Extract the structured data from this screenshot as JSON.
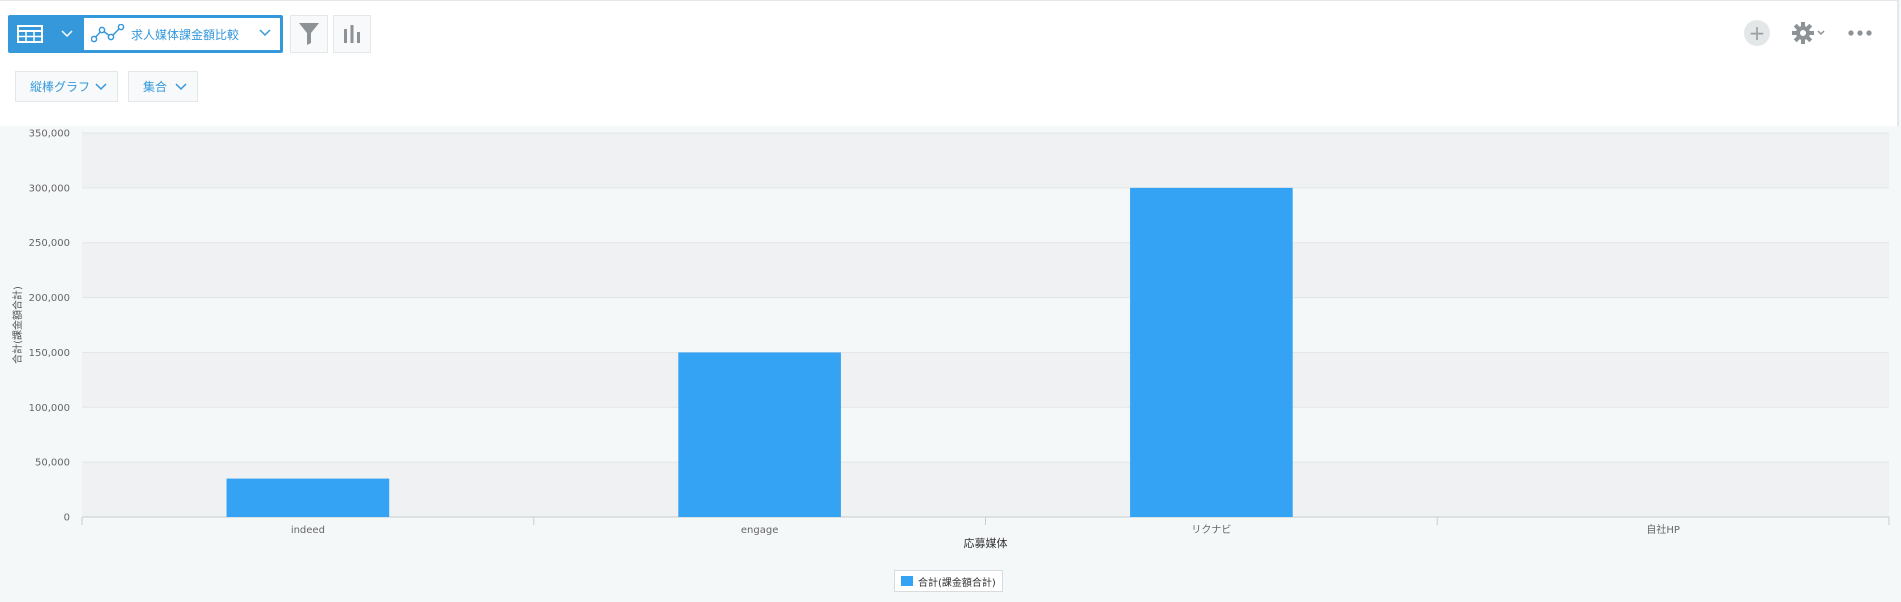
{
  "toolbar": {
    "table_view_icon": "table-icon",
    "chart_icon": "line-chart-icon",
    "selected_chart": "求人媒体課金額比較",
    "filter_icon": "filter-icon",
    "graph_icon": "bar-chart-icon"
  },
  "options": {
    "chart_type": "縦棒グラフ",
    "aggregation": "集合"
  },
  "header_actions": {
    "add_icon": "plus-icon",
    "settings_icon": "gear-icon",
    "more_icon": "more-icon"
  },
  "colors": {
    "accent": "#3498db",
    "bar": "#35a3f4"
  },
  "chart_data": {
    "type": "bar",
    "categories": [
      "indeed",
      "engage",
      "リクナビ",
      "自社HP"
    ],
    "series": [
      {
        "name": "合計(課金額合計)",
        "values": [
          35000,
          150000,
          300000,
          0
        ]
      }
    ],
    "xlabel": "応募媒体",
    "ylabel": "合計(課金額合計)",
    "ylim": [
      0,
      350000
    ],
    "yticks": [
      "0",
      "50,000",
      "100,000",
      "150,000",
      "200,000",
      "250,000",
      "300,000",
      "350,000"
    ],
    "grid": true,
    "legend": "bottom-center"
  }
}
